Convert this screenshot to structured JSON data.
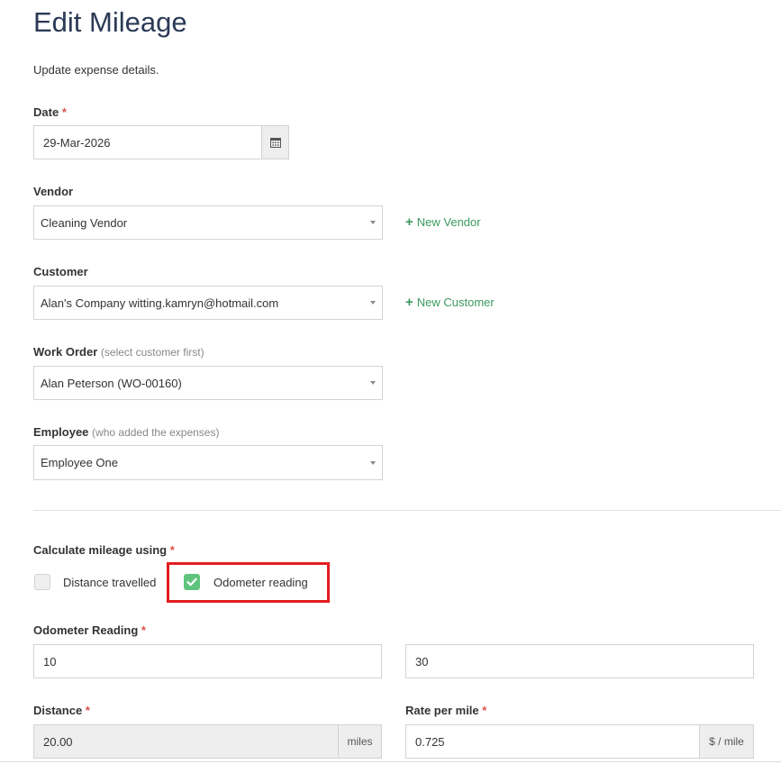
{
  "page": {
    "title": "Edit Mileage",
    "subtitle": "Update expense details."
  },
  "date": {
    "label": "Date",
    "required": "*",
    "value": "29-Mar-2026",
    "icon": "calendar-icon"
  },
  "vendor": {
    "label": "Vendor",
    "value": "Cleaning Vendor",
    "new_label": "New Vendor"
  },
  "customer": {
    "label": "Customer",
    "value": "Alan's Company witting.kamryn@hotmail.com",
    "new_label": "New Customer"
  },
  "work_order": {
    "label": "Work Order",
    "hint": "(select customer first)",
    "value": "Alan Peterson (WO-00160)"
  },
  "employee": {
    "label": "Employee",
    "hint": "(who added the expenses)",
    "value": "Employee One"
  },
  "calc": {
    "label": "Calculate mileage using",
    "required": "*",
    "options": [
      {
        "label": "Distance travelled",
        "checked": false
      },
      {
        "label": "Odometer reading",
        "checked": true
      }
    ]
  },
  "odometer": {
    "label": "Odometer Reading",
    "required": "*",
    "start": "10",
    "end": "30"
  },
  "distance": {
    "label": "Distance",
    "required": "*",
    "value": "20.00",
    "unit": "miles"
  },
  "rate": {
    "label": "Rate per mile",
    "required": "*",
    "value": "0.725",
    "unit": "$ / mile"
  },
  "colors": {
    "accent_green": "#3c9a5f",
    "checkbox_green": "#5fc47d",
    "highlight_red": "#e21d1d",
    "title": "#2b3a55"
  }
}
